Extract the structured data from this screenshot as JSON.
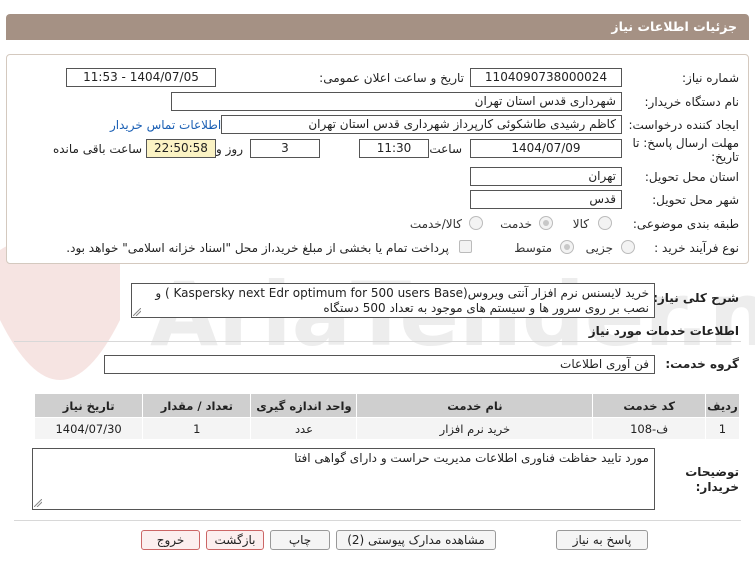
{
  "header": {
    "title": "جزئیات اطلاعات نیاز"
  },
  "form": {
    "need_number_label": "شماره نیاز:",
    "need_number": "1104090738000024",
    "announce_label": "تاریخ و ساعت اعلان عمومی:",
    "announce_value": "1404/07/05 - 11:53",
    "buyer_org_label": "نام دستگاه خریدار:",
    "buyer_org": "شهرداری قدس استان تهران",
    "creator_label": "ایجاد کننده درخواست:",
    "creator": "کاظم رشیدی طاشکوئی کارپرداز شهرداری قدس استان تهران",
    "contact_link": "اطلاعات تماس خریدار",
    "deadline_label_1": "مهلت ارسال پاسخ: تا",
    "deadline_label_2": "تاریخ:",
    "deadline_date": "1404/07/09",
    "time_label": "ساعت",
    "deadline_time": "11:30",
    "days_value": "3",
    "days_label": "روز و",
    "remaining_time": "22:50:58",
    "remaining_label": "ساعت باقی مانده",
    "province_label": "استان محل تحویل:",
    "province": "تهران",
    "city_label": "شهر محل تحویل:",
    "city": "قدس",
    "category_label": "طبقه بندی موضوعی:",
    "category_options": [
      "کالا",
      "خدمت",
      "کالا/خدمت"
    ],
    "category_selected": "خدمت",
    "purchase_type_label": "نوع فرآیند خرید :",
    "purchase_options": [
      "جزیی",
      "متوسط"
    ],
    "purchase_selected": "متوسط",
    "payment_note": "پرداخت تمام یا بخشی از مبلغ خرید،از محل \"اسناد خزانه اسلامی\" خواهد بود."
  },
  "description": {
    "label": "شرح کلی نیاز:",
    "text": "خرید لایسنس نرم افزار آنتی ویروس(Kaspersky next Edr optimum for 500 users Base ) و نصب بر روی سرور ها و سیستم های موجود به تعداد 500 دستگاه"
  },
  "services": {
    "section_title": "اطلاعات خدمات مورد نیاز",
    "group_label": "گروه خدمت:",
    "group_value": "فن آوری اطلاعات",
    "columns": [
      "ردیف",
      "کد خدمت",
      "نام خدمت",
      "واحد اندازه گیری",
      "تعداد / مقدار",
      "تاریخ نیاز"
    ],
    "rows": [
      [
        "1",
        "ف-108",
        "خرید نرم افزار",
        "عدد",
        "1",
        "1404/07/30"
      ]
    ]
  },
  "buyer_notes": {
    "label_1": "توضیحات",
    "label_2": "خریدار:",
    "text": "مورد تایید حفاظت فناوری اطلاعات مدیریت حراست و دارای گواهی افتا"
  },
  "buttons": {
    "reply": "پاسخ به نیاز",
    "docs": "مشاهده مدارک پیوستی (2)",
    "print": "چاپ",
    "back": "بازگشت",
    "exit": "خروج"
  },
  "colors": {
    "header_bg": "#a59184",
    "highlight": "#fbf3c4",
    "link": "#1a5fb4",
    "table_header": "#cfcfcf"
  }
}
